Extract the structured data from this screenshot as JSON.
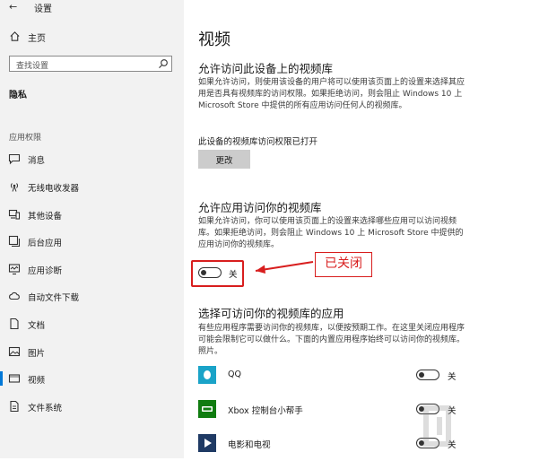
{
  "window": {
    "title": "设置"
  },
  "sidebar": {
    "home_label": "主页",
    "search_placeholder": "查找设置",
    "section_heading": "隐私",
    "group_heading": "应用权限",
    "items": [
      {
        "label": "消息",
        "icon": "message-icon"
      },
      {
        "label": "无线电收发器",
        "icon": "radio-icon"
      },
      {
        "label": "其他设备",
        "icon": "devices-icon"
      },
      {
        "label": "后台应用",
        "icon": "background-apps-icon"
      },
      {
        "label": "应用诊断",
        "icon": "diagnostics-icon"
      },
      {
        "label": "自动文件下载",
        "icon": "cloud-download-icon"
      },
      {
        "label": "文档",
        "icon": "document-icon"
      },
      {
        "label": "图片",
        "icon": "picture-icon"
      },
      {
        "label": "视频",
        "icon": "video-icon",
        "active": true
      },
      {
        "label": "文件系统",
        "icon": "file-system-icon"
      }
    ]
  },
  "main": {
    "title": "视频",
    "device_access": {
      "title": "允许访问此设备上的视频库",
      "description": "如果允许访问，则使用该设备的用户将可以使用该页面上的设置来选择其应用是否具有视频库的访问权限。如果拒绝访问，则会阻止 Windows 10 上 Microsoft Store 中提供的所有应用访问任何人的视频库。",
      "status": "此设备的视频库访问权限已打开",
      "button_label": "更改"
    },
    "app_access": {
      "title": "允许应用访问你的视频库",
      "description": "如果允许访问，你可以使用该页面上的设置来选择哪些应用可以访问视频库。如果拒绝访问，则会阻止 Windows 10 上 Microsoft Store 中提供的应用访问你的视频库。",
      "toggle_state": "关",
      "toggle_on": false
    },
    "annotation": {
      "text": "已关闭",
      "color": "#d81e1e"
    },
    "apps_section": {
      "title": "选择可访问你的视频库的应用",
      "description": "有些应用程序需要访问你的视频库，以便按预期工作。在这里关闭应用程序可能会限制它可以做什么。下面的内置应用程序始终可以访问你的视频库。照片。",
      "apps": [
        {
          "name": "QQ",
          "icon": "qq-icon",
          "icon_color": "#1aa3c8",
          "state": "关",
          "on": false
        },
        {
          "name": "Xbox 控制台小帮手",
          "icon": "xbox-icon",
          "icon_color": "#107c10",
          "state": "关",
          "on": false
        },
        {
          "name": "电影和电视",
          "icon": "movies-tv-icon",
          "icon_color": "#1f3a64",
          "state": "关",
          "on": false
        }
      ]
    }
  },
  "colors": {
    "accent": "#0078d7",
    "sidebar_bg": "#f2f2f2",
    "button_bg": "#cccccc"
  }
}
